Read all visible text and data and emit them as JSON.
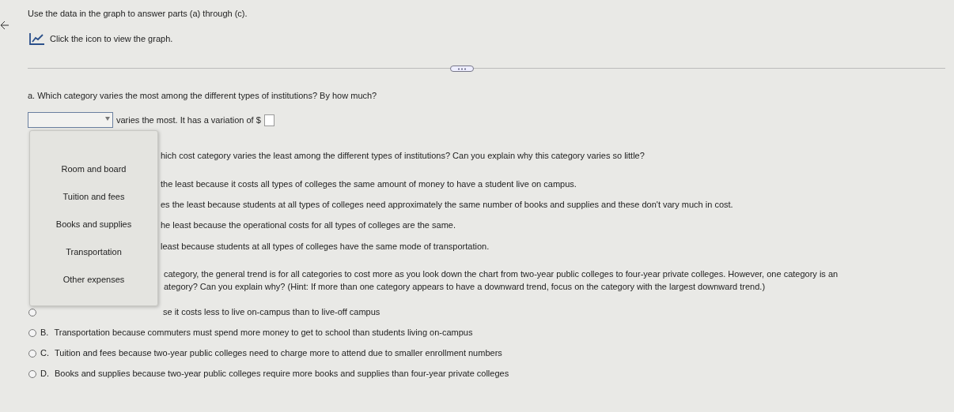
{
  "instructions": "Use the data in the graph to answer parts (a) through (c).",
  "graph_link": "Click the icon to view the graph.",
  "part_a": {
    "question": "a. Which category varies the most among the different types of institutions? By how much?",
    "sentence": "varies the most. It has a variation of $"
  },
  "dropdown": {
    "expanded": true,
    "options": [
      {
        "label": "Room and board",
        "selected": false
      },
      {
        "label": "Tuition and fees",
        "selected": false
      },
      {
        "label": "Books and supplies",
        "selected": false
      },
      {
        "label": "Transportation",
        "selected": false
      },
      {
        "label": "Other expenses",
        "selected": false
      }
    ]
  },
  "part_b": {
    "question": "hich cost category varies the least among the different types of institutions? Can you explain why this category varies so little?",
    "options": [
      "the least because it costs all types of colleges the same amount of money to have a student live on campus.",
      "es the least because students at all types of colleges need approximately the same number of books and supplies and these don't vary much in cost.",
      "he least because the operational costs for all types of colleges are the same.",
      "least because students at all types of colleges have the same mode of transportation."
    ]
  },
  "part_c": {
    "question": [
      "category, the general trend is for all categories to cost more as you look down the chart from two-year public colleges to four-year private colleges. However, one category is an",
      "ategory? Can you explain why? (Hint: If more than one category appears to have a downward trend, focus on the category with the largest downward trend.)"
    ],
    "options": [
      {
        "text": "se it costs less to live on-campus than to live-off campus",
        "selected": false
      },
      {
        "letter": "B.",
        "text": "Transportation because commuters must spend more money to get to school than students living on-campus",
        "selected": false
      },
      {
        "letter": "C.",
        "text": "Tuition and fees because two-year public colleges need to charge more to attend due to smaller enrollment numbers",
        "selected": false
      },
      {
        "letter": "D.",
        "text": "Books and supplies because two-year public colleges require more books and supplies than four-year private colleges",
        "selected": false
      }
    ]
  }
}
